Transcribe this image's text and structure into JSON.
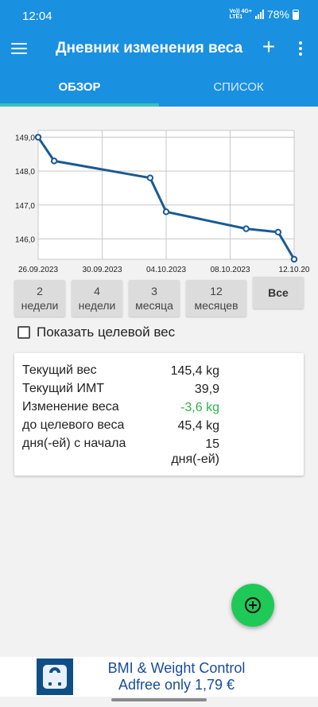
{
  "status_bar": {
    "time": "12:04",
    "net_top": "Vo)) 4G+",
    "net_bottom": "LTE1",
    "battery": "78%",
    "battery_level": 0.78
  },
  "app_bar": {
    "title": "Дневник изменения веса",
    "add_icon": "plus-icon",
    "menu_icon": "hamburger-icon",
    "more_icon": "more-vert-icon"
  },
  "tabs": [
    {
      "label": "ОБЗОР",
      "active": true
    },
    {
      "label": "СПИСОК",
      "active": false
    }
  ],
  "colors": {
    "primary": "#1a90e0",
    "tab_indicator": "#37c2b8",
    "line": "#1a5a94",
    "fab": "#1fc957",
    "positive_change": "#2fb34a"
  },
  "chart_data": {
    "type": "line",
    "x": [
      "26.09.2023",
      "27.09.2023",
      "03.10.2023",
      "04.10.2023",
      "09.10.2023",
      "11.10.2023",
      "12.10.2023"
    ],
    "series": [
      {
        "values": [
          149.0,
          148.3,
          147.8,
          146.8,
          146.3,
          146.2,
          145.4
        ]
      }
    ],
    "x_ticks": [
      "26.09.2023",
      "30.09.2023",
      "04.10.2023",
      "08.10.2023",
      "12.10.20"
    ],
    "y_ticks": [
      "149,0",
      "148,0",
      "147,0",
      "146,0"
    ],
    "ylim": [
      145.4,
      149.2
    ],
    "grid": true
  },
  "range_buttons": [
    {
      "line1": "2",
      "line2": "недели"
    },
    {
      "line1": "4",
      "line2": "недели"
    },
    {
      "line1": "3",
      "line2": "месяца"
    },
    {
      "line1": "12",
      "line2": "месяцев"
    },
    {
      "line1": "Все",
      "line2": ""
    }
  ],
  "target": {
    "label": "Показать целевой вес",
    "checked": false
  },
  "stats": {
    "current_weight_label": "Текущий вес",
    "current_weight_value": "145,4 kg",
    "bmi_label": "Текущий ИМТ",
    "bmi_value": "39,9",
    "change_label": "Изменение веса",
    "change_value": "-3,6 kg",
    "to_target_label": "до целевого веса",
    "to_target_value": "45,4 kg",
    "days_label": "дня(-ей) с начала",
    "days_value_line1": "15",
    "days_value_line2": "дня(-ей)"
  },
  "fab": {
    "icon": "add-circle-icon"
  },
  "ad": {
    "line1": "BMI & Weight Control",
    "line2": "Adfree only 1,79 €",
    "icon": "scale-icon"
  }
}
